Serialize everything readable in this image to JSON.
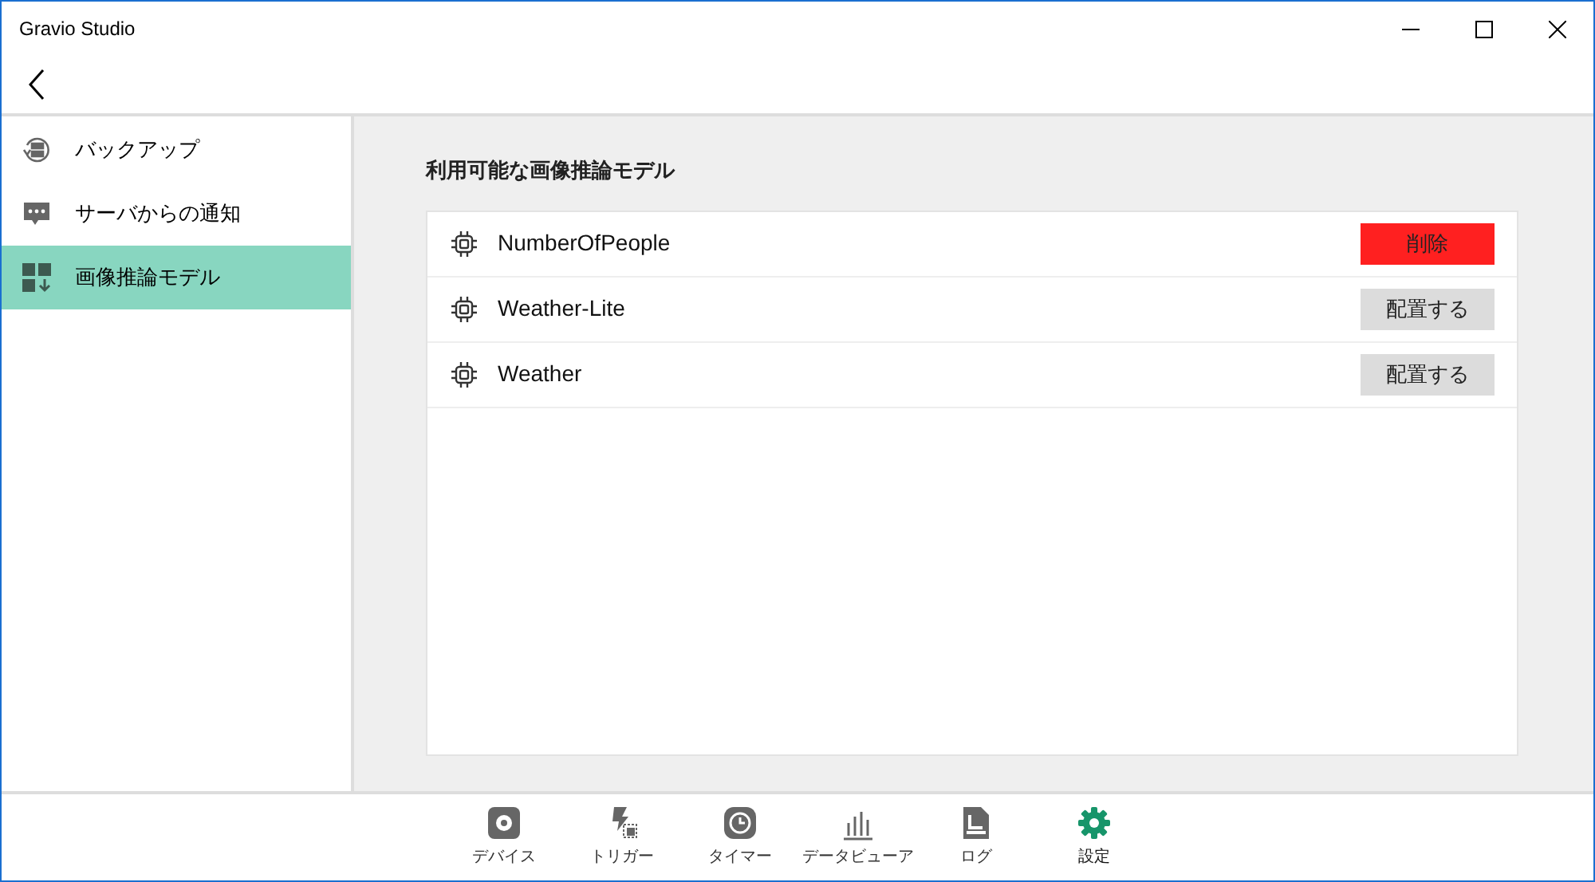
{
  "window": {
    "title": "Gravio Studio"
  },
  "sidebar": {
    "items": [
      {
        "label": "バックアップ",
        "kind": "backup",
        "selected": false
      },
      {
        "label": "サーバからの通知",
        "kind": "message",
        "selected": false
      },
      {
        "label": "画像推論モデル",
        "kind": "model",
        "selected": true
      }
    ]
  },
  "content": {
    "heading": "利用可能な画像推論モデル",
    "models": [
      {
        "name": "NumberOfPeople",
        "action": {
          "label": "削除",
          "kind": "delete"
        }
      },
      {
        "name": "Weather-Lite",
        "action": {
          "label": "配置する",
          "kind": "deploy"
        }
      },
      {
        "name": "Weather",
        "action": {
          "label": "配置する",
          "kind": "deploy"
        }
      }
    ]
  },
  "bottom_nav": [
    {
      "label": "デバイス",
      "kind": "device",
      "selected": false
    },
    {
      "label": "トリガー",
      "kind": "trigger",
      "selected": false
    },
    {
      "label": "タイマー",
      "kind": "timer",
      "selected": false
    },
    {
      "label": "データビューア",
      "kind": "chart",
      "selected": false
    },
    {
      "label": "ログ",
      "kind": "log",
      "selected": false
    },
    {
      "label": "設定",
      "kind": "settings",
      "selected": true
    }
  ]
}
